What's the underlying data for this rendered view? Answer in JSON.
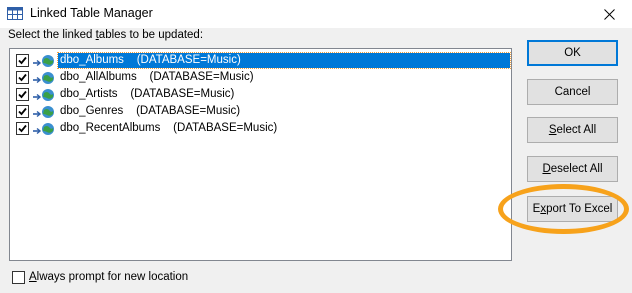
{
  "window": {
    "title": "Linked Table Manager",
    "icon": "table-link-icon"
  },
  "instructions": {
    "before": "Select the linked ",
    "accel": "t",
    "after": "ables to be updated:"
  },
  "tables": [
    {
      "name": "dbo_Albums",
      "source": "(DATABASE=Music)",
      "checked": true,
      "selected": true
    },
    {
      "name": "dbo_AllAlbums",
      "source": "(DATABASE=Music)",
      "checked": true,
      "selected": false
    },
    {
      "name": "dbo_Artists",
      "source": "(DATABASE=Music)",
      "checked": true,
      "selected": false
    },
    {
      "name": "dbo_Genres",
      "source": "(DATABASE=Music)",
      "checked": true,
      "selected": false
    },
    {
      "name": "dbo_RecentAlbums",
      "source": "(DATABASE=Music)",
      "checked": true,
      "selected": false
    }
  ],
  "buttons": {
    "ok": "OK",
    "cancel": "Cancel",
    "select_all_accel": "S",
    "select_all_rest": "elect All",
    "deselect_all_accel": "D",
    "deselect_all_rest": "eselect All",
    "export_before": "E",
    "export_accel": "x",
    "export_after": "port To Excel"
  },
  "prompt": {
    "accel": "A",
    "rest": "lways prompt for new location",
    "checked": false
  },
  "colors": {
    "selection": "#0078d7",
    "highlight_ring": "#f7a21b"
  }
}
